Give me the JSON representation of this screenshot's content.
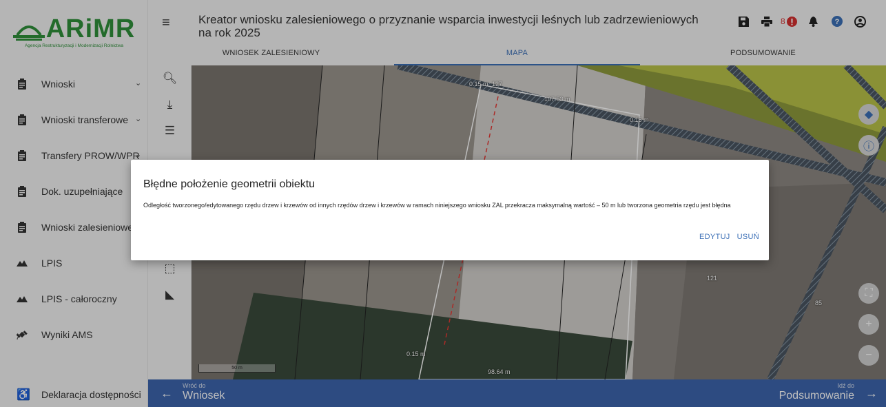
{
  "logo": {
    "name": "ARiMR",
    "subtitle": "Agencja Restrukturyzacji i Modernizacji Rolnictwa"
  },
  "sidebar": {
    "items": [
      {
        "label": "Wnioski",
        "icon": "clipboard-icon",
        "expandable": true
      },
      {
        "label": "Wnioski transferowe",
        "icon": "clipboard-icon",
        "expandable": true
      },
      {
        "label": "Transfery PROW/WPR",
        "icon": "clipboard-icon",
        "expandable": true
      },
      {
        "label": "Dok. uzupełniające",
        "icon": "clipboard-icon",
        "expandable": false
      },
      {
        "label": "Wnioski zalesieniowe",
        "icon": "clipboard-icon",
        "expandable": false
      },
      {
        "label": "LPIS",
        "icon": "mountain-icon",
        "expandable": false
      },
      {
        "label": "LPIS - całoroczny",
        "icon": "mountain-icon",
        "expandable": false
      },
      {
        "label": "Wyniki AMS",
        "icon": "satellite-icon",
        "expandable": false
      }
    ],
    "accessibility": "Deklaracja dostępności"
  },
  "header": {
    "title": "Kreator wniosku zalesieniowego o przyznanie wsparcia inwestycji leśnych lub zadrzewieniowych na rok 2025",
    "notification_count": "8",
    "tabs": [
      {
        "label": "WNIOSEK ZALESIENIOWY",
        "active": false
      },
      {
        "label": "MAPA",
        "active": true
      },
      {
        "label": "PODSUMOWANIE",
        "active": false
      }
    ]
  },
  "map": {
    "labels": {
      "l1": "0.15 m",
      "l2": "127",
      "l3": "107.53 m",
      "l4": "0.15 m",
      "l5": "121",
      "l6": "85",
      "l7": "0.15 m",
      "l8": "98.64 m"
    },
    "scale": "50 m"
  },
  "dialog": {
    "title": "Błędne położenie geometrii obiektu",
    "body": "Odległość tworzonego/edytowanego rzędu drzew i krzewów od innych rzędów drzew i krzewów w ramach niniejszego wniosku ZAL przekracza maksymalną wartość – 50 m lub tworzona geometria rzędu jest błędna",
    "edit": "EDYTUJ",
    "delete": "USUŃ"
  },
  "footer": {
    "back_small": "Wróć do",
    "back_big": "Wniosek",
    "next_small": "Idź do",
    "next_big": "Podsumowanie"
  },
  "colors": {
    "accent": "#3b6fb6",
    "brand_green": "#2f8f3a",
    "footer": "#3d65ad",
    "alert": "#d32f2f"
  }
}
